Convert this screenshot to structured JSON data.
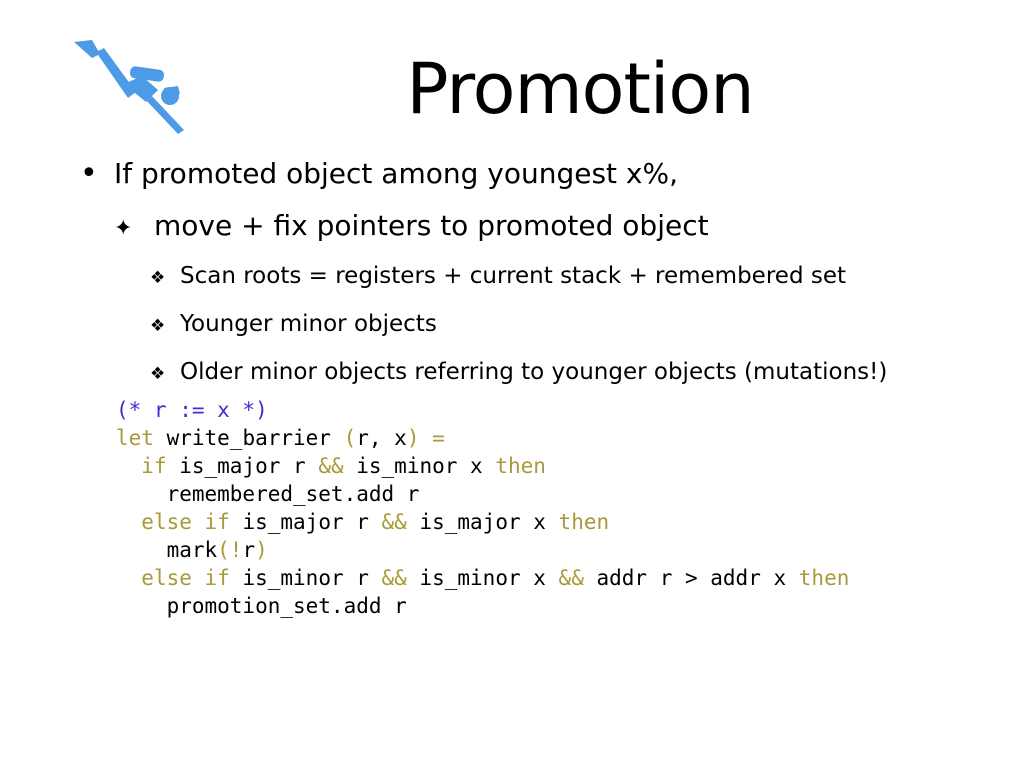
{
  "slide": {
    "title": "Promotion",
    "logo_icon": "scuba-diver-icon",
    "logo_color": "#4d9be6",
    "bullets": [
      {
        "marker": "•",
        "text": "If promoted object among youngest x%,"
      },
      {
        "marker": "✦",
        "text": "move + fix pointers to promoted object"
      },
      {
        "marker": "❖",
        "text": "Scan roots = registers + current stack + remembered set"
      },
      {
        "marker": "❖",
        "text": "Younger minor objects"
      },
      {
        "marker": "❖",
        "text": "Older minor objects referring to younger objects (mutations!)"
      }
    ]
  },
  "code": {
    "colors": {
      "keyword": "#a89a3a",
      "comment": "#3b2fcf",
      "plain": "#000000"
    },
    "lines": [
      [
        {
          "t": "(* r := x *)",
          "k": "cm"
        }
      ],
      [
        {
          "t": "let",
          "k": "kw"
        },
        {
          "t": " write_barrier ",
          "k": "pl"
        },
        {
          "t": "(",
          "k": "kw"
        },
        {
          "t": "r, x",
          "k": "pl"
        },
        {
          "t": ") =",
          "k": "kw"
        }
      ],
      [
        {
          "t": "  ",
          "k": "pl"
        },
        {
          "t": "if",
          "k": "kw"
        },
        {
          "t": " is_major r ",
          "k": "pl"
        },
        {
          "t": "&&",
          "k": "kw"
        },
        {
          "t": " is_minor x ",
          "k": "pl"
        },
        {
          "t": "then",
          "k": "kw"
        }
      ],
      [
        {
          "t": "    remembered_set.add r",
          "k": "pl"
        }
      ],
      [
        {
          "t": "  ",
          "k": "pl"
        },
        {
          "t": "else if",
          "k": "kw"
        },
        {
          "t": " is_major r ",
          "k": "pl"
        },
        {
          "t": "&&",
          "k": "kw"
        },
        {
          "t": " is_major x ",
          "k": "pl"
        },
        {
          "t": "then",
          "k": "kw"
        }
      ],
      [
        {
          "t": "    mark",
          "k": "pl"
        },
        {
          "t": "(!",
          "k": "kw"
        },
        {
          "t": "r",
          "k": "pl"
        },
        {
          "t": ")",
          "k": "kw"
        }
      ],
      [
        {
          "t": "  ",
          "k": "pl"
        },
        {
          "t": "else if",
          "k": "kw"
        },
        {
          "t": " is_minor r ",
          "k": "pl"
        },
        {
          "t": "&&",
          "k": "kw"
        },
        {
          "t": " is_minor x ",
          "k": "pl"
        },
        {
          "t": "&&",
          "k": "kw"
        },
        {
          "t": " addr r > addr x ",
          "k": "pl"
        },
        {
          "t": "then",
          "k": "kw"
        }
      ],
      [
        {
          "t": "    promotion_set.add r",
          "k": "pl"
        }
      ]
    ]
  }
}
